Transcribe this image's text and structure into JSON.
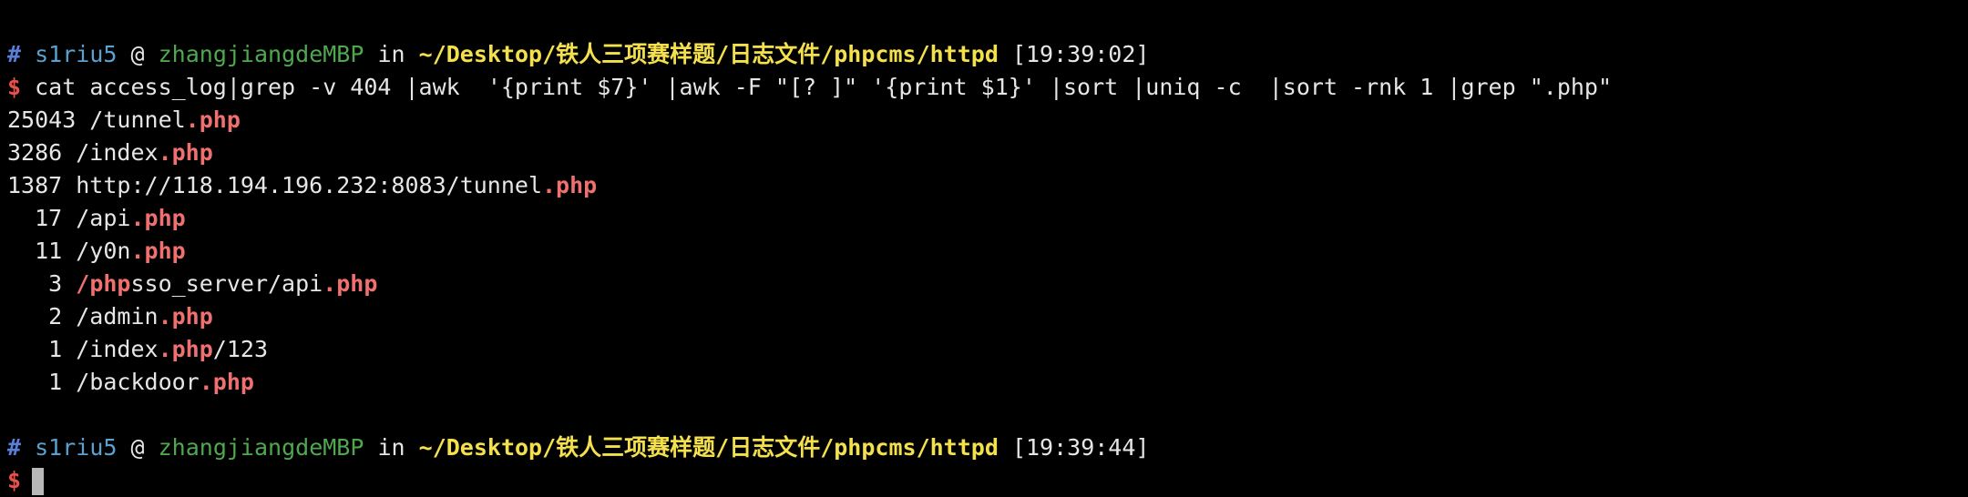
{
  "prompt1": {
    "hash": "#",
    "user": "s1riu5",
    "at": "@",
    "host": "zhangjiangdeMBP",
    "in": "in",
    "path": "~/Desktop/铁人三项赛样题/日志文件/phpcms/httpd",
    "time": "[19:39:02]"
  },
  "command": {
    "dollar": "$",
    "text": "cat access_log|grep -v 404 |awk  '{print $7}' |awk -F \"[? ]\" '{print $1}' |sort |uniq -c  |sort -rnk 1 |grep \".php\""
  },
  "output": [
    {
      "pre": "25043 /tunnel",
      "hl": ".php",
      "post": ""
    },
    {
      "pre": "3286 /index",
      "hl": ".php",
      "post": ""
    },
    {
      "pre": "1387 http://118.194.196.232:8083/tunnel",
      "hl": ".php",
      "post": ""
    },
    {
      "pre": "  17 /api",
      "hl": ".php",
      "post": ""
    },
    {
      "pre": "  11 /y0n",
      "hl": ".php",
      "post": ""
    },
    {
      "pre": "   3 ",
      "hl": "/php",
      "post": "sso_server/api",
      "hl2": ".php"
    },
    {
      "pre": "   2 /admin",
      "hl": ".php",
      "post": ""
    },
    {
      "pre": "   1 /index",
      "hl": ".php",
      "post": "/123"
    },
    {
      "pre": "   1 /backdoor",
      "hl": ".php",
      "post": ""
    }
  ],
  "prompt2": {
    "hash": "#",
    "user": "s1riu5",
    "at": "@",
    "host": "zhangjiangdeMBP",
    "in": "in",
    "path": "~/Desktop/铁人三项赛样题/日志文件/phpcms/httpd",
    "time": "[19:39:44]"
  },
  "prompt2_dollar": "$",
  "colors": {
    "background": "#000000",
    "user": "#5aa0d0",
    "host": "#4fa84f",
    "path": "#f4e04d",
    "dollar": "#e8504a",
    "highlight": "#f07070"
  }
}
